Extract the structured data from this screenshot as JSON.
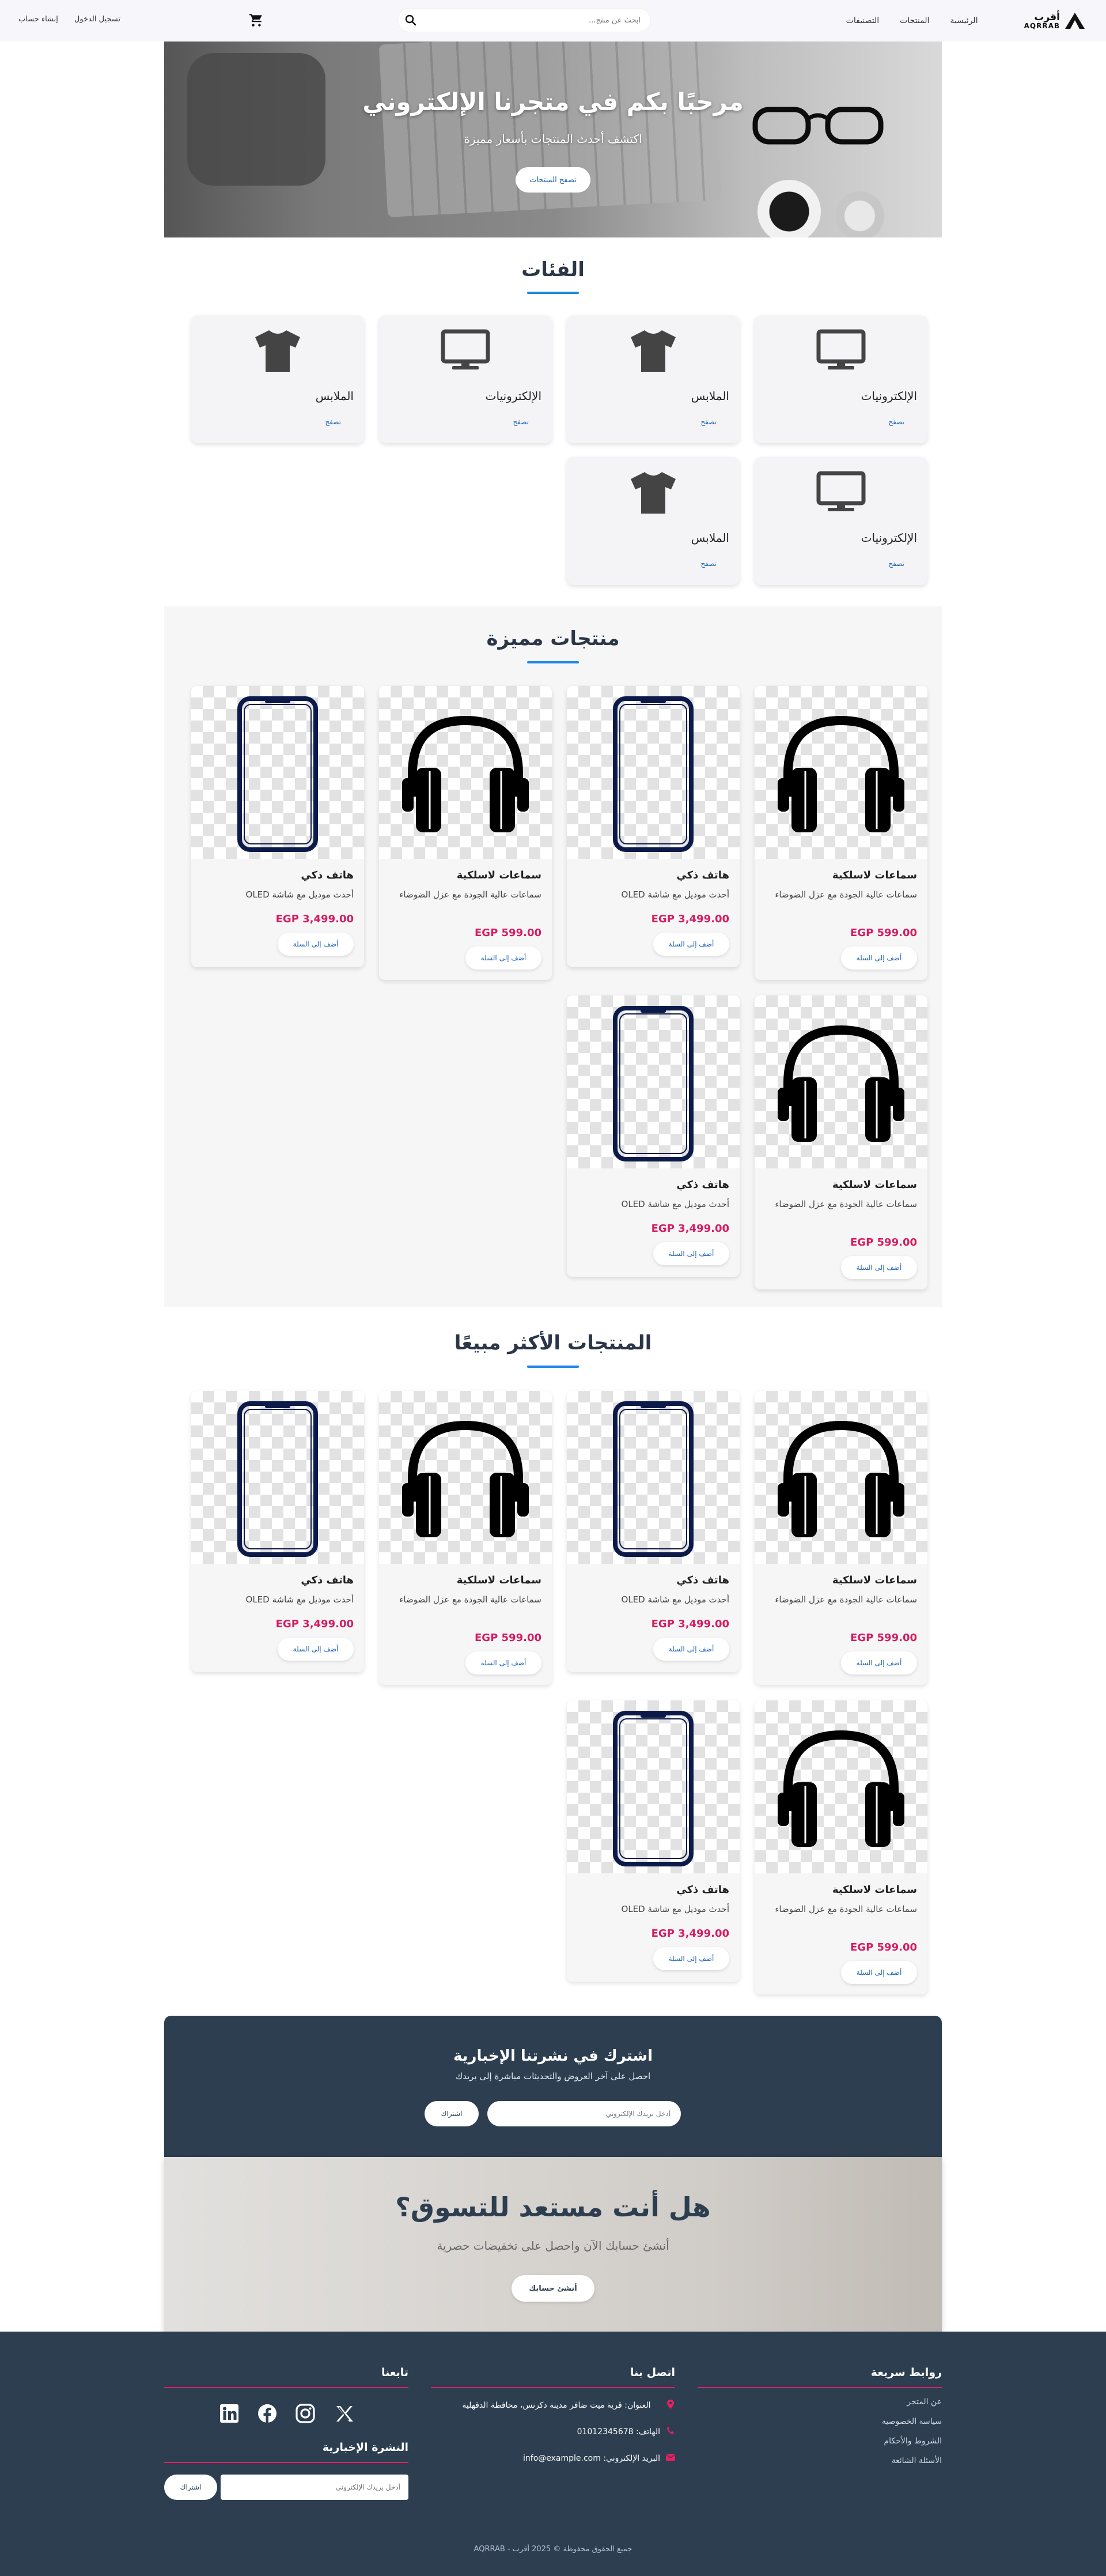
{
  "header": {
    "brand_ar": "أقرب",
    "brand_en": "AQRRAB",
    "nav": [
      "الرئيسية",
      "المنتجات",
      "التصنيفات"
    ],
    "search_placeholder": "ابحث عن منتج...",
    "auth": [
      "تسجيل الدخول",
      "إنشاء حساب"
    ]
  },
  "hero": {
    "title": "مرحبًا بكم في متجرنا الإلكتروني",
    "subtitle": "اكتشف أحدث المنتجات بأسعار مميزة",
    "button": "تصفح المنتجات"
  },
  "categories": {
    "title": "الفئات",
    "items": [
      {
        "name": "الإلكترونيات",
        "icon": "monitor-icon",
        "link": "تصفح"
      },
      {
        "name": "الملابس",
        "icon": "tshirt-icon",
        "link": "تصفح"
      },
      {
        "name": "الإلكترونيات",
        "icon": "monitor-icon",
        "link": "تصفح"
      },
      {
        "name": "الملابس",
        "icon": "tshirt-icon",
        "link": "تصفح"
      },
      {
        "name": "الإلكترونيات",
        "icon": "monitor-icon",
        "link": "تصفح"
      },
      {
        "name": "الملابس",
        "icon": "tshirt-icon",
        "link": "تصفح"
      }
    ]
  },
  "featured": {
    "title": "منتجات مميزة",
    "products": [
      {
        "name": "سماعات لاسلكية",
        "desc": "سماعات عالية الجودة مع عزل الضوضاء",
        "price": "EGP 599.00",
        "button": "أضف إلى السلة",
        "image": "headphones-image"
      },
      {
        "name": "هاتف ذكي",
        "desc": "أحدث موديل مع شاشة OLED",
        "price": "EGP 3,499.00",
        "button": "أضف إلى السلة",
        "image": "phone-image"
      },
      {
        "name": "سماعات لاسلكية",
        "desc": "سماعات عالية الجودة مع عزل الضوضاء",
        "price": "EGP 599.00",
        "button": "أضف إلى السلة",
        "image": "headphones-image"
      },
      {
        "name": "هاتف ذكي",
        "desc": "أحدث موديل مع شاشة OLED",
        "price": "EGP 3,499.00",
        "button": "أضف إلى السلة",
        "image": "phone-image"
      },
      {
        "name": "سماعات لاسلكية",
        "desc": "سماعات عالية الجودة مع عزل الضوضاء",
        "price": "EGP 599.00",
        "button": "أضف إلى السلة",
        "image": "headphones-image"
      },
      {
        "name": "هاتف ذكي",
        "desc": "أحدث موديل مع شاشة OLED",
        "price": "EGP 3,499.00",
        "button": "أضف إلى السلة",
        "image": "phone-image"
      }
    ]
  },
  "bestsellers": {
    "title": "المنتجات الأكثر مبيعًا",
    "products": [
      {
        "name": "سماعات لاسلكية",
        "desc": "سماعات عالية الجودة مع عزل الضوضاء",
        "price": "EGP 599.00",
        "button": "أضف إلى السلة",
        "image": "headphones-image"
      },
      {
        "name": "هاتف ذكي",
        "desc": "أحدث موديل مع شاشة OLED",
        "price": "EGP 3,499.00",
        "button": "أضف إلى السلة",
        "image": "phone-image"
      },
      {
        "name": "سماعات لاسلكية",
        "desc": "سماعات عالية الجودة مع عزل الضوضاء",
        "price": "EGP 599.00",
        "button": "أضف إلى السلة",
        "image": "headphones-image"
      },
      {
        "name": "هاتف ذكي",
        "desc": "أحدث موديل مع شاشة OLED",
        "price": "EGP 3,499.00",
        "button": "أضف إلى السلة",
        "image": "phone-image"
      },
      {
        "name": "سماعات لاسلكية",
        "desc": "سماعات عالية الجودة مع عزل الضوضاء",
        "price": "EGP 599.00",
        "button": "أضف إلى السلة",
        "image": "headphones-image"
      },
      {
        "name": "هاتف ذكي",
        "desc": "أحدث موديل مع شاشة OLED",
        "price": "EGP 3,499.00",
        "button": "أضف إلى السلة",
        "image": "phone-image"
      }
    ]
  },
  "newsletter": {
    "title": "اشترك في نشرتنا الإخبارية",
    "subtitle": "احصل على آخر العروض والتحديثات مباشرة إلى بريدك",
    "placeholder": "أدخل بريدك الإلكتروني",
    "button": "اشتراك"
  },
  "cta": {
    "title": "هل أنت مستعد للتسوق؟",
    "subtitle": "أنشئ حسابك الآن واحصل على تخفيضات حصرية",
    "button": "أنشئ حسابك"
  },
  "footer": {
    "quick_links_title": "روابط سريعة",
    "quick_links": [
      "عن المتجر",
      "سياسة الخصوصية",
      "الشروط والأحكام",
      "الأسئلة الشائعة"
    ],
    "contact_title": "اتصل بنا",
    "address": "العنوان: قرية ميت ضافر مدينة دكرنس، محافظة الدقهلية",
    "phone": "الهاتف: 01012345678",
    "email": "البريد الإلكتروني: info@example.com",
    "follow_title": "تابعنا",
    "newsletter_title": "النشرة الإخبارية",
    "newsletter_placeholder": "أدخل بريدك الإلكتروني",
    "newsletter_button": "اشتراك",
    "copyright": "جميع الحقوق محفوظة © 2025 أقرب - AQRRAB"
  },
  "colors": {
    "accent": "#1e88e5",
    "price": "#d81b60",
    "footer_bg": "#2c3e50",
    "footer_rule": "#e91e63"
  }
}
